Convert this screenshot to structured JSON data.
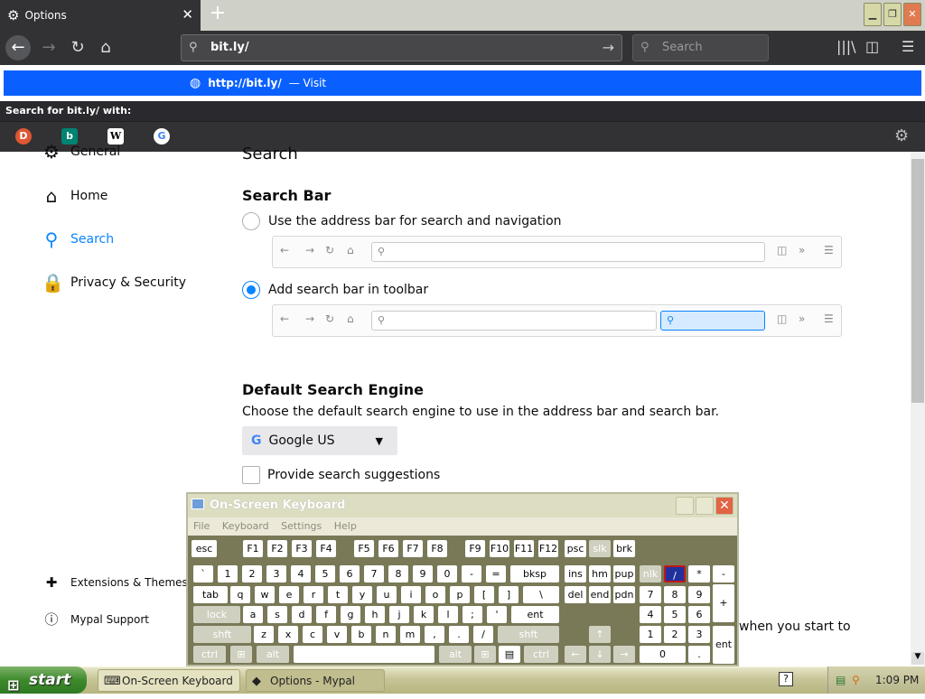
{
  "browser": {
    "tab_title": "Options",
    "url": "bit.ly/",
    "search_placeholder": "Search",
    "suggestion_url": "http://bit.ly/",
    "suggestion_action": "— Visit",
    "search_with": "Search for bit.ly/ with:",
    "engines": [
      "duckduckgo-icon",
      "bing-icon",
      "wikipedia-icon",
      "google-icon"
    ]
  },
  "sidebar": {
    "items": [
      {
        "label": "General",
        "icon": "gear-icon"
      },
      {
        "label": "Home",
        "icon": "home-icon"
      },
      {
        "label": "Search",
        "icon": "search-icon"
      },
      {
        "label": "Privacy & Security",
        "icon": "lock-icon"
      }
    ],
    "footer": [
      {
        "label": "Extensions & Themes",
        "icon": "puzzle-icon"
      },
      {
        "label": "Mypal Support",
        "icon": "help-icon"
      }
    ]
  },
  "main": {
    "page_title": "Search",
    "search_bar_heading": "Search Bar",
    "option_address_bar": "Use the address bar for search and navigation",
    "option_toolbar": "Add search bar in toolbar",
    "default_engine_heading": "Default Search Engine",
    "default_engine_desc": "Choose the default search engine to use in the address bar and search bar.",
    "engine_selected": "Google US",
    "provide_suggestions": "Provide search suggestions",
    "partial_text": "when you start to"
  },
  "osk": {
    "title": "On-Screen Keyboard",
    "menu": [
      "File",
      "Keyboard",
      "Settings",
      "Help"
    ]
  },
  "taskbar": {
    "start": "start",
    "tasks": [
      "On-Screen Keyboard",
      "Options - Mypal"
    ],
    "clock": "1:09 PM"
  },
  "colors": {
    "accent": "#0a84ff",
    "url_dropdown": "#0a60ff",
    "osk_bg": "#757553"
  }
}
